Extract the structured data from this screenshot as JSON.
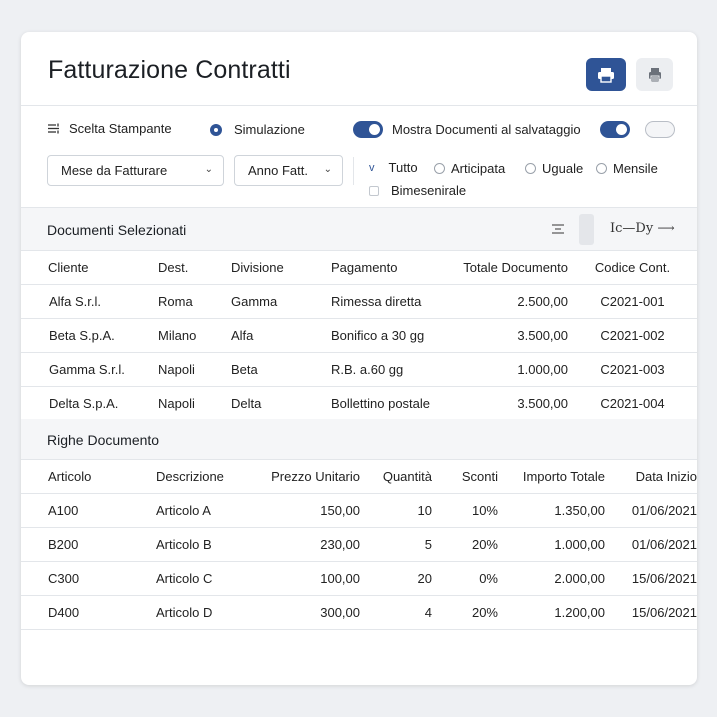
{
  "header": {
    "title": "Fatturazione Contratti"
  },
  "options": {
    "printer_choice": "Scelta Stampante",
    "simulation": "Simulazione",
    "show_docs": "Mostra Documenti al salvataggio"
  },
  "filters": {
    "month_select": "Mese da Fatturare",
    "year_select": "Anno Fatt.",
    "check_mark": "v",
    "frequency": {
      "all": "Tutto",
      "advance": "Articipata",
      "equal": "Uguale",
      "monthly": "Mensile",
      "bimonthly": "Bimesenirale"
    }
  },
  "documents": {
    "title": "Documenti Selezionati",
    "toolbar_glyph": "Ic—Dy",
    "columns": [
      "Cliente",
      "Dest.",
      "Divisione",
      "Pagamento",
      "Totale Documento",
      "Codice Cont."
    ],
    "rows": [
      [
        "Alfa S.r.l.",
        "Roma",
        "Gamma",
        "Rimessa diretta",
        "2.500,00",
        "C2021-001"
      ],
      [
        "Beta S.p.A.",
        "Milano",
        "Alfa",
        "Bonifico a 30 gg",
        "3.500,00",
        "C2021-002"
      ],
      [
        "Gamma S.r.l.",
        "Napoli",
        "Beta",
        "R.B. a.60 gg",
        "1.000,00",
        "C2021-003"
      ],
      [
        "Delta S.p.A.",
        "Napoli",
        "Delta",
        "Bollettino postale",
        "3.500,00",
        "C2021-004"
      ]
    ]
  },
  "lines": {
    "title": "Righe Documento",
    "columns": [
      "Articolo",
      "Descrizione",
      "Prezzo Unitario",
      "Quantità",
      "Sconti",
      "Importo Totale",
      "Data Inizio"
    ],
    "rows": [
      [
        "A100",
        "Articolo A",
        "150,00",
        "10",
        "10%",
        "1.350,00",
        "01/06/2021"
      ],
      [
        "B200",
        "Articolo B",
        "230,00",
        "5",
        "20%",
        "1.000,00",
        "01/06/2021"
      ],
      [
        "C300",
        "Articolo C",
        "100,00",
        "20",
        "0%",
        "2.000,00",
        "15/06/2021"
      ],
      [
        "D400",
        "Articolo D",
        "300,00",
        "4",
        "20%",
        "1.200,00",
        "15/06/2021"
      ]
    ]
  },
  "colors": {
    "accent": "#2f5496",
    "header_bg": "#f5f6f8",
    "border": "#e3e6ea"
  },
  "icons": {
    "print": "print-icon",
    "printer_alt": "printer-alt-icon",
    "settings": "sliders-icon",
    "filter": "filter-lines-icon"
  }
}
